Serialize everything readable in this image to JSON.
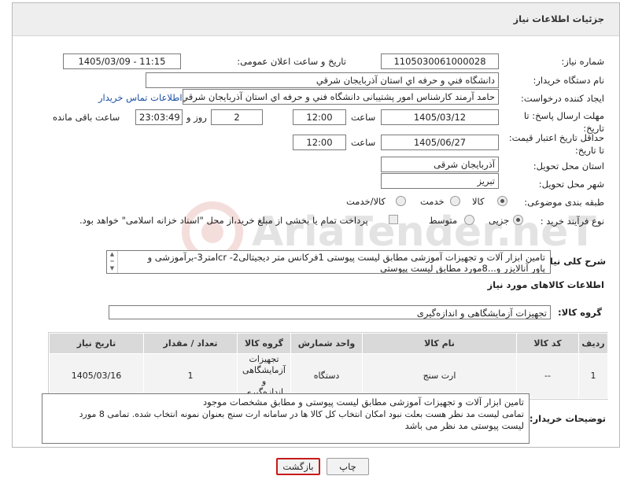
{
  "page": {
    "title": "جزئیات اطلاعات نیاز"
  },
  "labels": {
    "need_number": "شماره نیاز:",
    "announce_datetime": "تاریخ و ساعت اعلان عمومی:",
    "buyer_org": "نام دستگاه خریدار:",
    "requester": "ایجاد کننده درخواست:",
    "send_deadline": "مهلت ارسال پاسخ: تا تاریخ:",
    "price_validity": "حداقل تاریخ اعتبار قیمت: تا تاریخ:",
    "time": "ساعت",
    "day_and": "روز و",
    "time_left": "ساعت باقی مانده",
    "province": "استان محل تحویل:",
    "city": "شهر محل تحویل:",
    "category": "طبقه بندی موضوعی:",
    "process_type": "نوع فرآیند خرید :",
    "general_desc": "شرح کلی نیاز:",
    "goods_info": "اطلاعات کالاهای مورد نیاز",
    "goods_group": "گروه کالا:",
    "buyer_notes": "توضیحات خریدار:"
  },
  "fields": {
    "need_number": "1105030061000028",
    "announce_datetime": "1405/03/09 - 11:15",
    "buyer_org": "دانشگاه فني و حرفه اي استان آذربايجان شرقي",
    "requester": "حامد آرمند کارشناس امور پشتیبانی دانشگاه فني و حرفه اي استان آذربايجان شرقي",
    "contact_link": "اطلاعات تماس خریدار",
    "send_date": "1405/03/12",
    "send_time": "12:00",
    "days": "2",
    "remaining": "23:03:49",
    "validity_date": "1405/06/27",
    "validity_time": "12:00",
    "province": "آذربایجان شرقی",
    "city": "تبریز",
    "goods_group": "تجهیزات آزمایشگاهی و اندازه‌گیری"
  },
  "category_options": [
    "کالا",
    "خدمت",
    "کالا/خدمت"
  ],
  "category_selected": "کالا",
  "process_options": [
    "جزیی",
    "متوسط"
  ],
  "process_selected": "جزیی",
  "payment_note": "پرداخت تمام یا بخشی از مبلغ خرید،از محل \"اسناد خزانه اسلامی\" خواهد بود.",
  "general_desc_lines": [
    "تامین ابزار آلات و تجهیزات آموزشی مطابق لیست پیوستی 1فرکانس متر دیجیتالی2- lcrمتر3-برآموزشی و",
    "پاور آنالایزر و...8مورد مطابق لیست پیوستی"
  ],
  "table": {
    "headers": [
      "ردیف",
      "کد کالا",
      "نام کالا",
      "واحد شمارش",
      "گروه کالا",
      "تعداد / مقدار",
      "تاریخ نیاز"
    ],
    "rows": [
      {
        "row": "1",
        "code": "--",
        "name": "ارت سنج",
        "unit": "دستگاه",
        "group": "تجهیزات آزمایشگاهی و اندازه‌گیری",
        "qty": "1",
        "date": "1405/03/16"
      }
    ]
  },
  "buyer_notes_lines": [
    "تامین ابزار آلات و تجهیزات آموزشی مطابق لیست پیوستی و مطابق مشخصات موجود",
    "تمامی لیست مد نظر هست بعلت نبود امکان انتخاب کل کالا ها در سامانه ارت سنج بعنوان نمونه انتخاب شده. تمامی 8 مورد",
    "لیست پیوستی مد نظر می باشد"
  ],
  "buttons": {
    "print": "چاپ",
    "back": "بازگشت"
  },
  "watermark": "AriaTender.neT"
}
